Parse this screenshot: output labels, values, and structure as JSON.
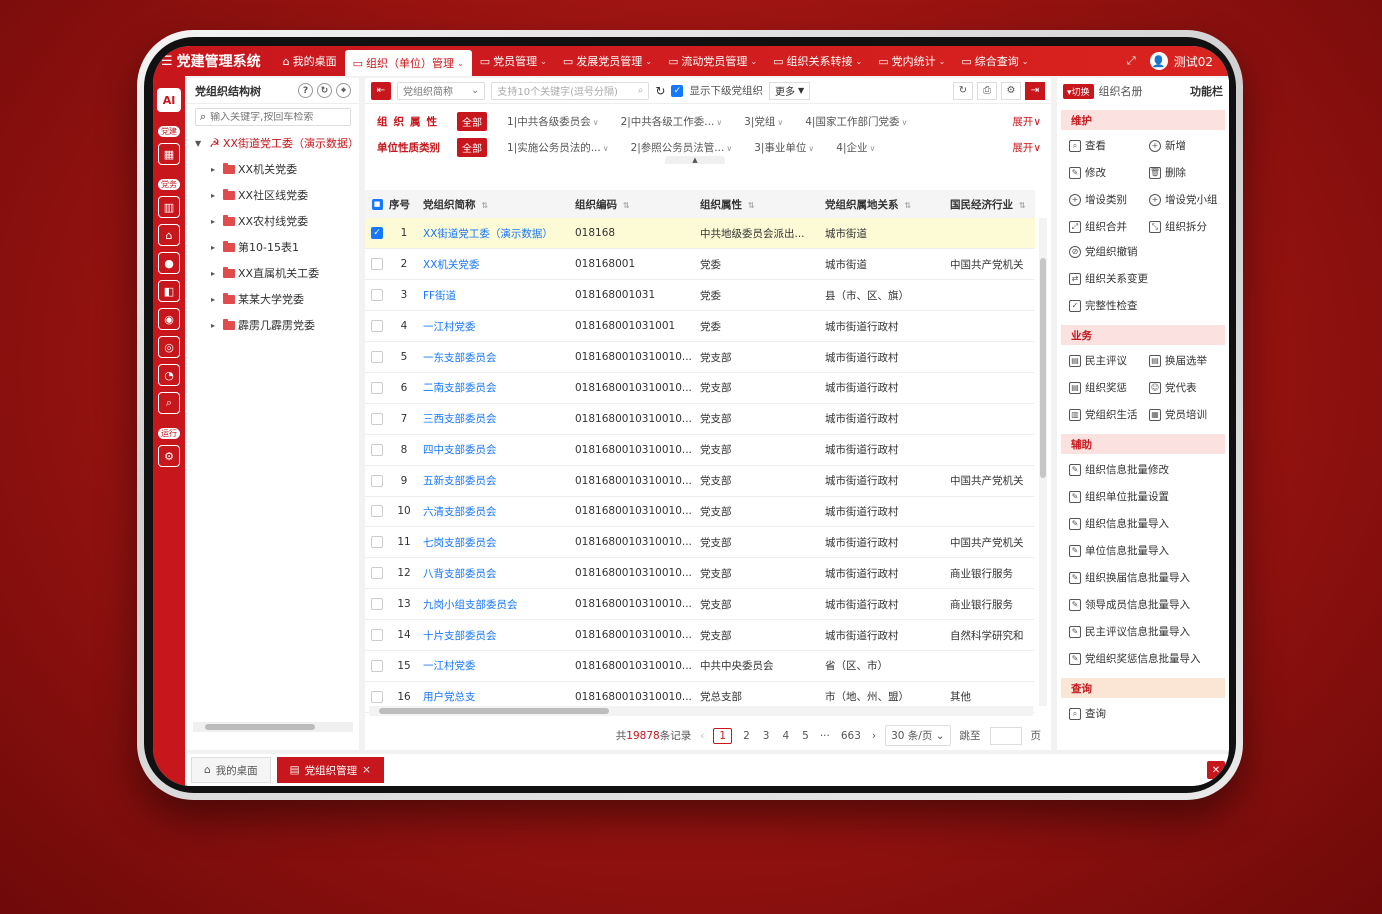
{
  "app": {
    "title": "党建管理系统",
    "user": "测试02"
  },
  "nav": [
    {
      "label": "我的桌面",
      "icon": "home-icon",
      "active": false,
      "chev": false
    },
    {
      "label": "组织（单位）管理",
      "icon": "folder-icon",
      "active": true,
      "chev": true
    },
    {
      "label": "党员管理",
      "icon": "folder-icon",
      "active": false,
      "chev": true
    },
    {
      "label": "发展党员管理",
      "icon": "folder-icon",
      "active": false,
      "chev": true
    },
    {
      "label": "流动党员管理",
      "icon": "folder-icon",
      "active": false,
      "chev": true
    },
    {
      "label": "组织关系转接",
      "icon": "folder-icon",
      "active": false,
      "chev": true
    },
    {
      "label": "党内统计",
      "icon": "folder-icon",
      "active": false,
      "chev": true
    },
    {
      "label": "综合查询",
      "icon": "folder-icon",
      "active": false,
      "chev": true
    }
  ],
  "rail": {
    "ai": "AI",
    "tag1": "党建",
    "tag2": "党务",
    "tag3": "运行"
  },
  "tree": {
    "title": "党组织结构树",
    "search_placeholder": "输入关键字,按回车检索",
    "root": "XX街道党工委（演示数据）",
    "children": [
      "XX机关党委",
      "XX社区线党委",
      "XX农村线党委",
      "第10-15表1",
      "XX直属机关工委",
      "某某大学党委",
      "霹雳几霹雳党委"
    ]
  },
  "toolbar": {
    "name_select": "党组织简称",
    "keyword_placeholder": "支持10个关键字(逗号分隔)",
    "show_sub_label": "显示下级党组织",
    "more_label": "更多"
  },
  "filters": {
    "row1": {
      "label": "组织属性",
      "all": "全部",
      "options": [
        "1|中共各级委员会",
        "2|中共各级工作委...",
        "3|党组",
        "4|国家工作部门党委"
      ],
      "expand": "展开"
    },
    "row2": {
      "label": "单位性质类别",
      "all": "全部",
      "options": [
        "1|实施公务员法的...",
        "2|参照公务员法管...",
        "3|事业单位",
        "4|企业"
      ],
      "expand": "展开"
    }
  },
  "table": {
    "headers": {
      "idx": "序号",
      "name": "党组织简称",
      "code": "组织编码",
      "attr": "组织属性",
      "rel": "党组织属地关系",
      "ind": "国民经济行业"
    },
    "rows": [
      {
        "idx": "1",
        "name": "XX街道党工委（演示数据）",
        "code": "018168",
        "attr": "中共地级委员会派出...",
        "rel": "城市街道",
        "ind": "",
        "checked": true
      },
      {
        "idx": "2",
        "name": "XX机关党委",
        "code": "018168001",
        "attr": "党委",
        "rel": "城市街道",
        "ind": "中国共产党机关",
        "checked": false
      },
      {
        "idx": "3",
        "name": "FF街道",
        "code": "018168001031",
        "attr": "党委",
        "rel": "县（市、区、旗）",
        "ind": "",
        "checked": false
      },
      {
        "idx": "4",
        "name": "一江村党委",
        "code": "018168001031001",
        "attr": "党委",
        "rel": "城市街道行政村",
        "ind": "",
        "checked": false
      },
      {
        "idx": "5",
        "name": "一东支部委员会",
        "code": "0181680010310010...",
        "attr": "党支部",
        "rel": "城市街道行政村",
        "ind": "",
        "checked": false
      },
      {
        "idx": "6",
        "name": "二南支部委员会",
        "code": "0181680010310010...",
        "attr": "党支部",
        "rel": "城市街道行政村",
        "ind": "",
        "checked": false
      },
      {
        "idx": "7",
        "name": "三西支部委员会",
        "code": "0181680010310010...",
        "attr": "党支部",
        "rel": "城市街道行政村",
        "ind": "",
        "checked": false
      },
      {
        "idx": "8",
        "name": "四中支部委员会",
        "code": "0181680010310010...",
        "attr": "党支部",
        "rel": "城市街道行政村",
        "ind": "",
        "checked": false
      },
      {
        "idx": "9",
        "name": "五新支部委员会",
        "code": "0181680010310010...",
        "attr": "党支部",
        "rel": "城市街道行政村",
        "ind": "中国共产党机关",
        "checked": false
      },
      {
        "idx": "10",
        "name": "六清支部委员会",
        "code": "0181680010310010...",
        "attr": "党支部",
        "rel": "城市街道行政村",
        "ind": "",
        "checked": false
      },
      {
        "idx": "11",
        "name": "七岗支部委员会",
        "code": "0181680010310010...",
        "attr": "党支部",
        "rel": "城市街道行政村",
        "ind": "中国共产党机关",
        "checked": false
      },
      {
        "idx": "12",
        "name": "八背支部委员会",
        "code": "0181680010310010...",
        "attr": "党支部",
        "rel": "城市街道行政村",
        "ind": "商业银行服务",
        "checked": false
      },
      {
        "idx": "13",
        "name": "九岗小组支部委员会",
        "code": "0181680010310010...",
        "attr": "党支部",
        "rel": "城市街道行政村",
        "ind": "商业银行服务",
        "checked": false
      },
      {
        "idx": "14",
        "name": "十片支部委员会",
        "code": "0181680010310010...",
        "attr": "党支部",
        "rel": "城市街道行政村",
        "ind": "自然科学研究和",
        "checked": false
      },
      {
        "idx": "15",
        "name": "一江村党委",
        "code": "0181680010310010...",
        "attr": "中共中央委员会",
        "rel": "省（区、市）",
        "ind": "",
        "checked": false
      },
      {
        "idx": "16",
        "name": "用户党总支",
        "code": "0181680010310010...",
        "attr": "党总支部",
        "rel": "市（地、州、盟）",
        "ind": "其他",
        "checked": false
      }
    ]
  },
  "pager": {
    "total_prefix": "共",
    "total": "19878",
    "total_suffix": "条记录",
    "pages": [
      "1",
      "2",
      "3",
      "4",
      "5"
    ],
    "ellipsis": "···",
    "last": "663",
    "page_size": "30 条/页",
    "goto_label": "跳至",
    "page_unit": "页"
  },
  "side": {
    "switch": "切换",
    "register": "组织名册",
    "title": "功能栏",
    "sections": [
      {
        "title": "维护",
        "layout": "mixed",
        "grid": [
          "查看",
          "新增",
          "修改",
          "删除",
          "增设类别",
          "增设党小组",
          "组织合并",
          "组织拆分"
        ],
        "list": [
          "党组织撤销",
          "组织关系变更",
          "完整性检查"
        ]
      },
      {
        "title": "业务",
        "layout": "grid",
        "grid": [
          "民主评议",
          "换届选举",
          "组织奖惩",
          "党代表",
          "党组织生活",
          "党员培训"
        ],
        "list": []
      },
      {
        "title": "辅助",
        "layout": "list",
        "grid": [],
        "list": [
          "组织信息批量修改",
          "组织单位批量设置",
          "组织信息批量导入",
          "单位信息批量导入",
          "组织换届信息批量导入",
          "领导成员信息批量导入",
          "民主评议信息批量导入",
          "党组织奖惩信息批量导入"
        ]
      },
      {
        "title": "查询",
        "layout": "list",
        "grid": [],
        "list": [
          "查询"
        ]
      }
    ]
  },
  "bottom_tabs": [
    {
      "label": "我的桌面",
      "active": false
    },
    {
      "label": "党组织管理",
      "active": true
    }
  ]
}
